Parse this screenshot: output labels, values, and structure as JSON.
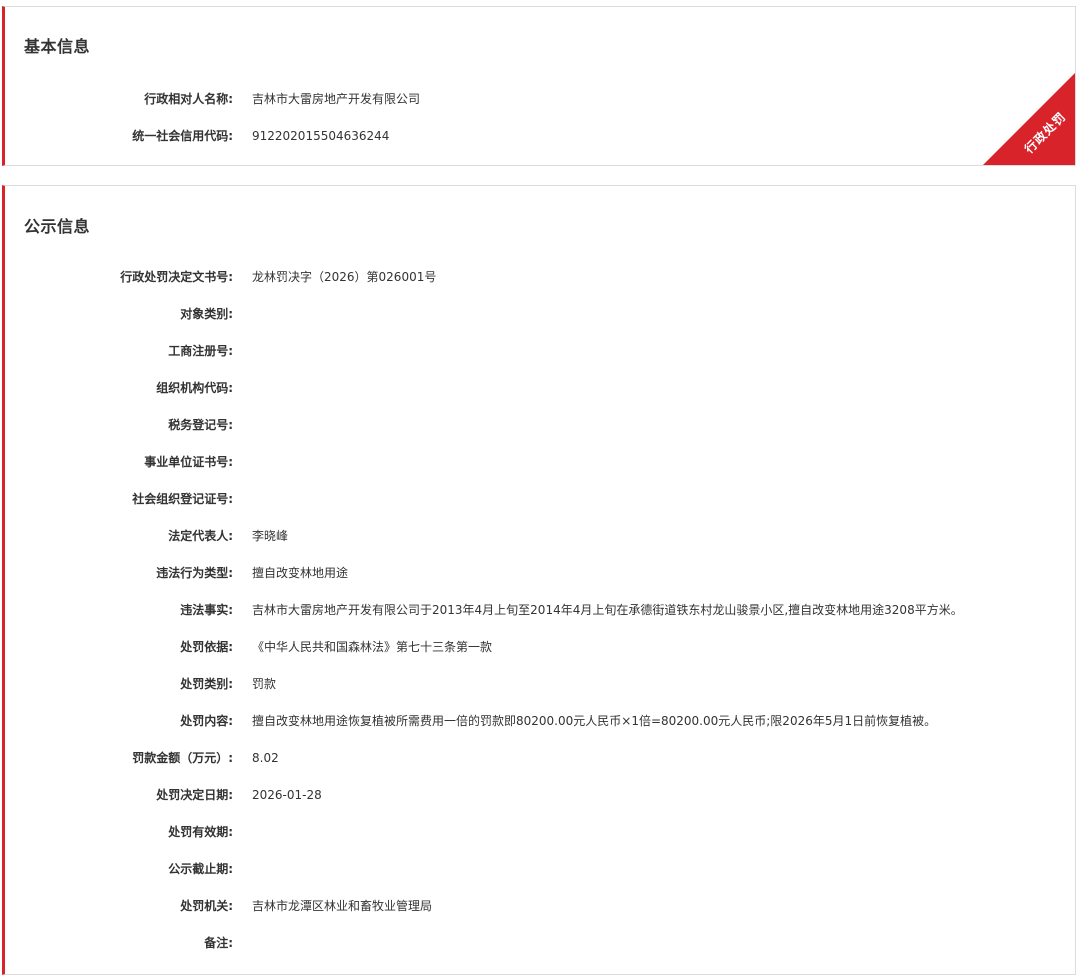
{
  "basic": {
    "title": "基本信息",
    "ribbon": "行政处罚",
    "rows": [
      {
        "label": "行政相对人名称:",
        "value": "吉林市大雷房地产开发有限公司"
      },
      {
        "label": "统一社会信用代码:",
        "value": "912202015504636244"
      }
    ]
  },
  "public": {
    "title": "公示信息",
    "rows": [
      {
        "label": "行政处罚决定文书号:",
        "value": "龙林罚决字（2026）第026001号"
      },
      {
        "label": "对象类别:",
        "value": ""
      },
      {
        "label": "工商注册号:",
        "value": ""
      },
      {
        "label": "组织机构代码:",
        "value": ""
      },
      {
        "label": "税务登记号:",
        "value": ""
      },
      {
        "label": "事业单位证书号:",
        "value": ""
      },
      {
        "label": "社会组织登记证号:",
        "value": ""
      },
      {
        "label": "法定代表人:",
        "value": "李晓峰"
      },
      {
        "label": "违法行为类型:",
        "value": "擅自改变林地用途"
      },
      {
        "label": "违法事实:",
        "value": "吉林市大雷房地产开发有限公司于2013年4月上旬至2014年4月上旬在承德街道铁东村龙山骏景小区,擅自改变林地用途3208平方米。"
      },
      {
        "label": "处罚依据:",
        "value": "《中华人民共和国森林法》第七十三条第一款"
      },
      {
        "label": "处罚类别:",
        "value": "罚款"
      },
      {
        "label": "处罚内容:",
        "value": "擅自改变林地用途恢复植被所需费用一倍的罚款即80200.00元人民币×1倍=80200.00元人民币;限2026年5月1日前恢复植被。"
      },
      {
        "label": "罚款金额（万元）:",
        "value": "8.02"
      },
      {
        "label": "处罚决定日期:",
        "value": "2026-01-28"
      },
      {
        "label": "处罚有效期:",
        "value": ""
      },
      {
        "label": "公示截止期:",
        "value": ""
      },
      {
        "label": "处罚机关:",
        "value": "吉林市龙潭区林业和畜牧业管理局"
      },
      {
        "label": "备注:",
        "value": ""
      }
    ]
  },
  "colors": {
    "accent": "#d9232b",
    "text": "#333333",
    "border": "#dcdcdc"
  }
}
